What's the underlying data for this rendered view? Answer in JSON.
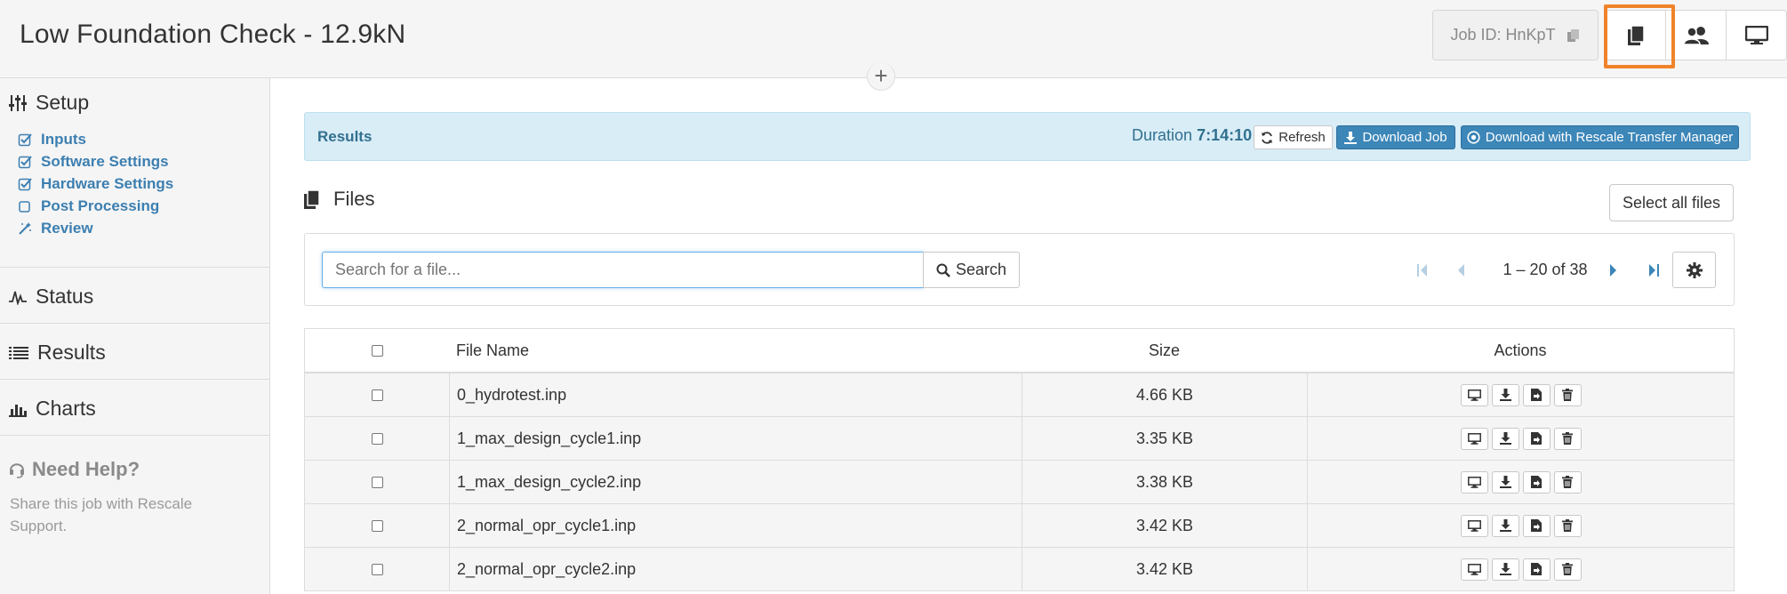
{
  "header": {
    "title": "Low Foundation Check - 12.9kN",
    "job_id_label": "Job ID: HnKpT",
    "buttons": [
      {
        "icon": "files-icon",
        "active": true
      },
      {
        "icon": "users-icon"
      },
      {
        "icon": "monitor-icon"
      }
    ]
  },
  "sidebar": {
    "setup_title": "Setup",
    "setup_items": [
      {
        "label": "Inputs",
        "icon": "checked-square-icon"
      },
      {
        "label": "Software Settings",
        "icon": "checked-square-icon"
      },
      {
        "label": "Hardware Settings",
        "icon": "checked-square-icon"
      },
      {
        "label": "Post Processing",
        "icon": "empty-square-icon"
      },
      {
        "label": "Review",
        "icon": "magic-wand-icon"
      }
    ],
    "status_title": "Status",
    "results_title": "Results",
    "charts_title": "Charts",
    "help_title": "Need Help?",
    "help_text": "Share this job with Rescale Support."
  },
  "results_bar": {
    "title": "Results",
    "duration_label": "Duration",
    "duration_value": "7:14:10",
    "refresh_label": "Refresh",
    "download_job_label": "Download Job",
    "download_rtm_label": "Download with Rescale Transfer Manager"
  },
  "files": {
    "title": "Files",
    "select_all_label": "Select all files",
    "search_placeholder": "Search for a file...",
    "search_button_label": "Search",
    "pagination": "1 – 20 of 38",
    "columns": {
      "name": "File Name",
      "size": "Size",
      "actions": "Actions"
    },
    "rows": [
      {
        "name": "0_hydrotest.inp",
        "size": "4.66 KB"
      },
      {
        "name": "1_max_design_cycle1.inp",
        "size": "3.35 KB"
      },
      {
        "name": "1_max_design_cycle2.inp",
        "size": "3.38 KB"
      },
      {
        "name": "2_normal_opr_cycle1.inp",
        "size": "3.42 KB"
      },
      {
        "name": "2_normal_opr_cycle2.inp",
        "size": "3.42 KB"
      }
    ]
  },
  "colors": {
    "accent": "#3c86b8",
    "link": "#3c7fb1",
    "highlight": "#f0832a",
    "info_bg": "#d9edf7"
  }
}
